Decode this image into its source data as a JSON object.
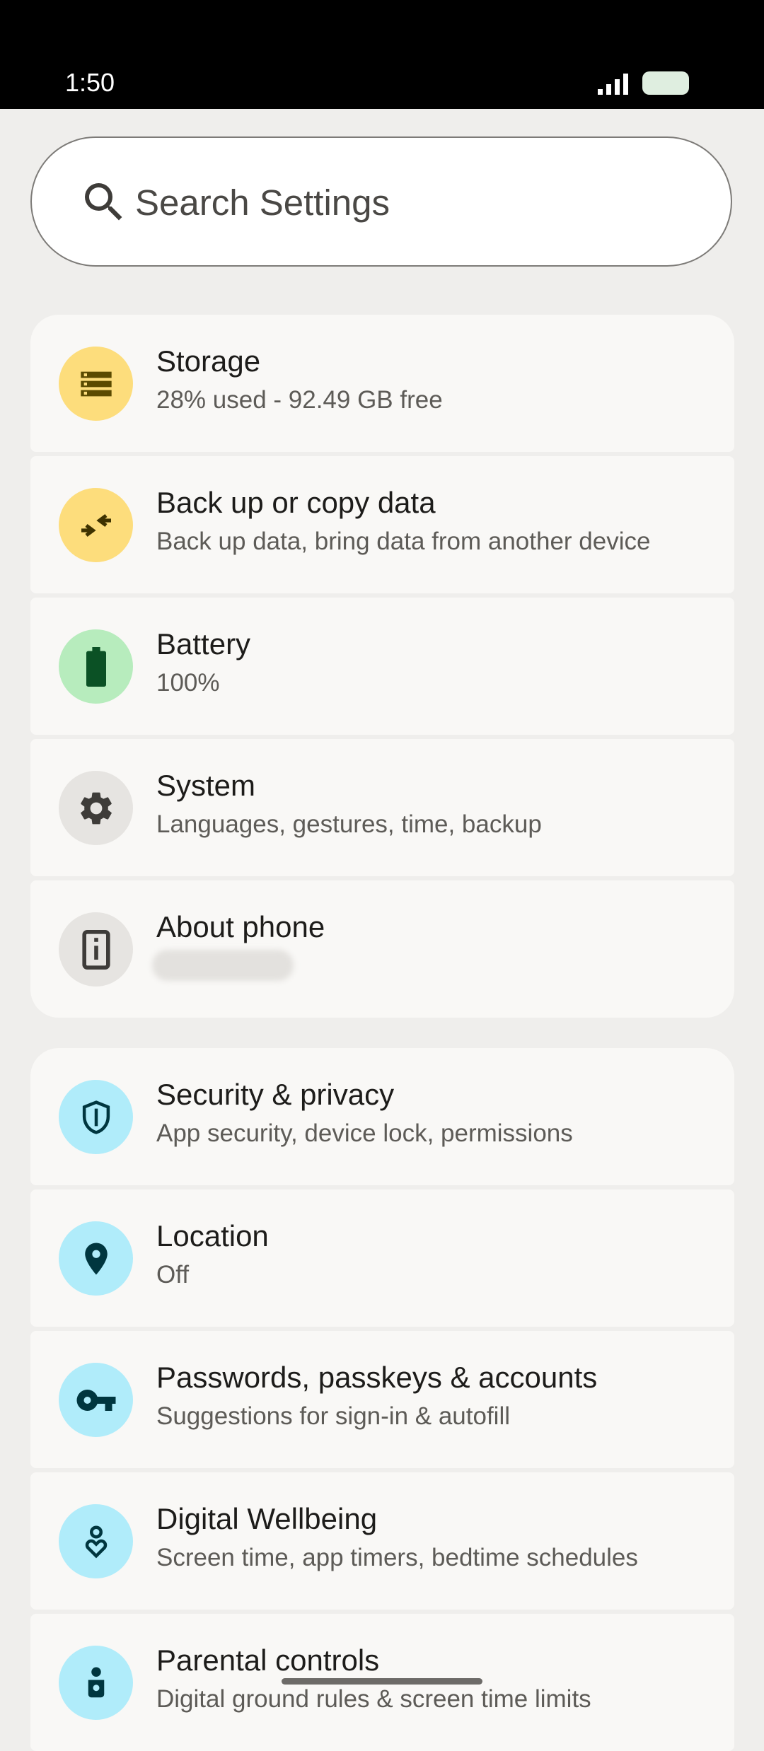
{
  "status_bar": {
    "time": "1:50"
  },
  "search": {
    "placeholder": "Search Settings"
  },
  "groups": [
    {
      "items": [
        {
          "title": "Storage",
          "subtitle": "28% used - 92.49 GB free",
          "icon": "storage-icon",
          "color": "#fddd7c"
        },
        {
          "title": "Back up or copy data",
          "subtitle": "Back up data, bring data from another device",
          "icon": "copy-data-icon",
          "color": "#fddd7c"
        },
        {
          "title": "Battery",
          "subtitle": "100%",
          "icon": "battery-icon",
          "color": "#b7ecbd"
        },
        {
          "title": "System",
          "subtitle": "Languages, gestures, time, backup",
          "icon": "gear-icon",
          "color": "#e6e4e1"
        },
        {
          "title": "About phone",
          "subtitle": "",
          "icon": "phone-info-icon",
          "color": "#e6e4e1"
        }
      ]
    },
    {
      "items": [
        {
          "title": "Security & privacy",
          "subtitle": "App security, device lock, permissions",
          "icon": "shield-icon",
          "color": "#b0ecfa"
        },
        {
          "title": "Location",
          "subtitle": "Off",
          "icon": "location-pin-icon",
          "color": "#b0ecfa"
        },
        {
          "title": "Passwords, passkeys & accounts",
          "subtitle": "Suggestions for sign-in & autofill",
          "icon": "key-icon",
          "color": "#b0ecfa"
        },
        {
          "title": "Digital Wellbeing",
          "subtitle": "Screen time, app timers, bedtime schedules",
          "icon": "wellbeing-icon",
          "color": "#b0ecfa"
        },
        {
          "title": "Parental controls",
          "subtitle": "Digital ground rules & screen time limits",
          "icon": "child-icon",
          "color": "#b0ecfa"
        }
      ]
    }
  ]
}
